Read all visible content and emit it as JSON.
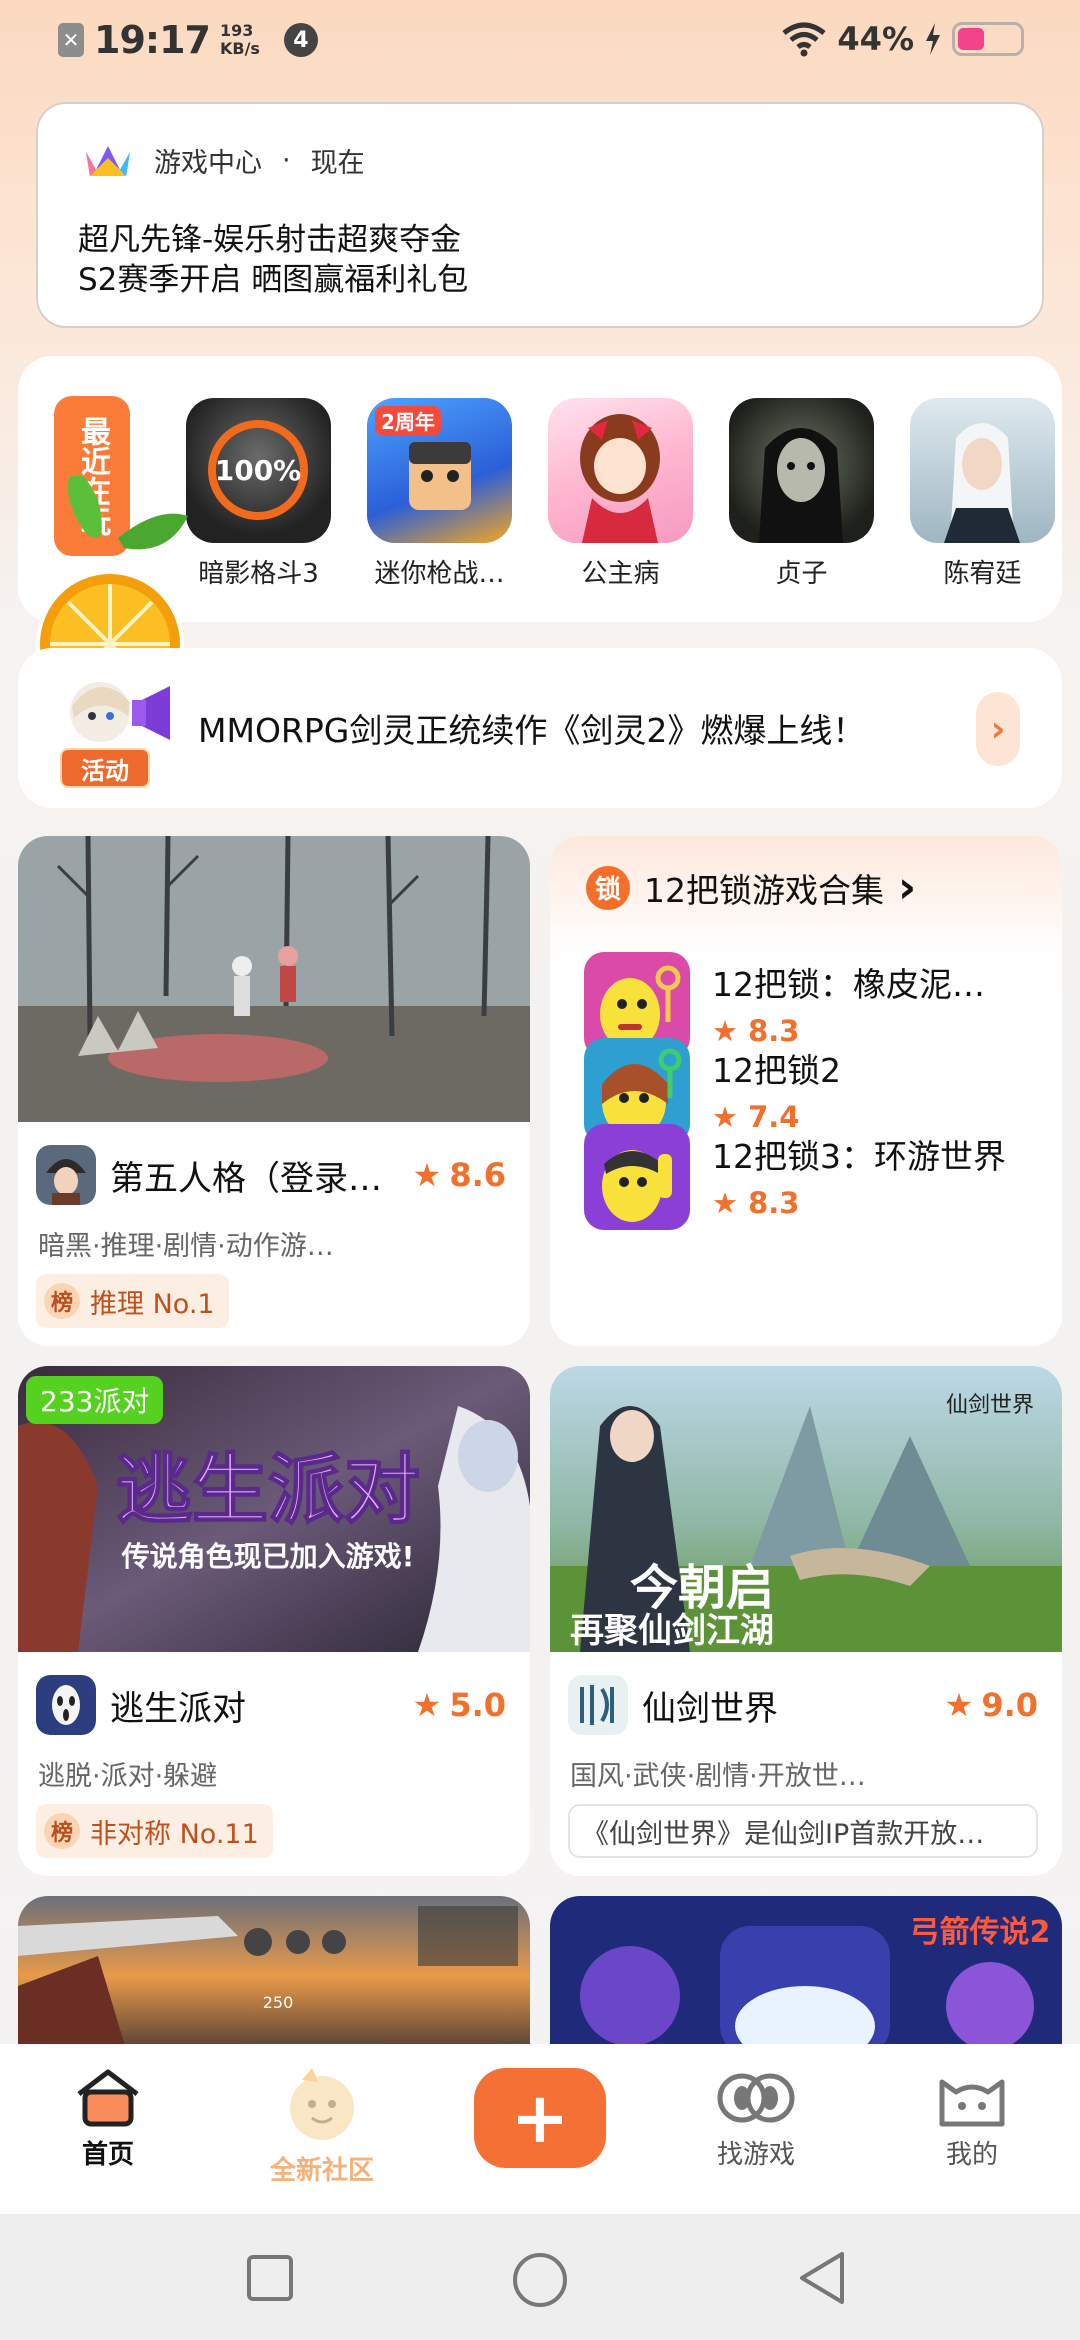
{
  "status_bar": {
    "time": "19:17",
    "speed_value": "193",
    "speed_unit": "KB/s",
    "notif_count": "4",
    "battery": "44%"
  },
  "notification": {
    "app_name": "游戏中心",
    "separator": "·",
    "time": "现在",
    "line1": "超凡先锋-娱乐射击超爽夺金",
    "line2": "S2赛季开启 晒图赢福利礼包"
  },
  "recent": {
    "tag": "最近在玩",
    "games": [
      {
        "name": "暗影格斗3",
        "progress": "100%"
      },
      {
        "name": "迷你枪战…",
        "badge": "2周年"
      },
      {
        "name": "公主病"
      },
      {
        "name": "贞子"
      },
      {
        "name": "陈宥廷"
      }
    ]
  },
  "activity": {
    "tag": "活动",
    "text": "MMORPG剑灵正统续作《剑灵2》燃爆上线！",
    "arrow": "›"
  },
  "cards": {
    "card1": {
      "name": "第五人格（登录…",
      "rating": "8.6",
      "tags": "暗黑·推理·剧情·动作游…",
      "rank_badge": "榜",
      "rank_text": "推理 No.1"
    },
    "collection": {
      "logo": "锁",
      "title": "12把锁游戏合集",
      "chevron": "›",
      "items": [
        {
          "name": "12把锁：橡皮泥…",
          "rating": "8.3"
        },
        {
          "name": "12把锁2",
          "rating": "7.4"
        },
        {
          "name": "12把锁3：环游世界",
          "rating": "8.3"
        }
      ]
    },
    "card3": {
      "corner_tag": "233派对",
      "banner_title": "逃生派对",
      "banner_sub": "传说角色现已加入游戏!",
      "name": "逃生派对",
      "rating": "5.0",
      "tags": "逃脱·派对·躲避",
      "rank_badge": "榜",
      "rank_text": "非对称 No.11"
    },
    "card4": {
      "banner_title": "今朝启",
      "banner_sub": "再聚仙剑江湖",
      "brand": "仙剑世界",
      "name": "仙剑世界",
      "rating": "9.0",
      "tags": "国风·武侠·剧情·开放世…",
      "desc": "《仙剑世界》是仙剑IP首款开放…"
    },
    "card5": {
      "hud_value": "250"
    },
    "card6": {
      "brand": "弓箭传说2"
    }
  },
  "bottom_nav": {
    "home": "首页",
    "community": "全新社区",
    "add": "+",
    "find": "找游戏",
    "mine": "我的"
  },
  "colors": {
    "accent": "#f57034",
    "rating": "#f0702c"
  }
}
